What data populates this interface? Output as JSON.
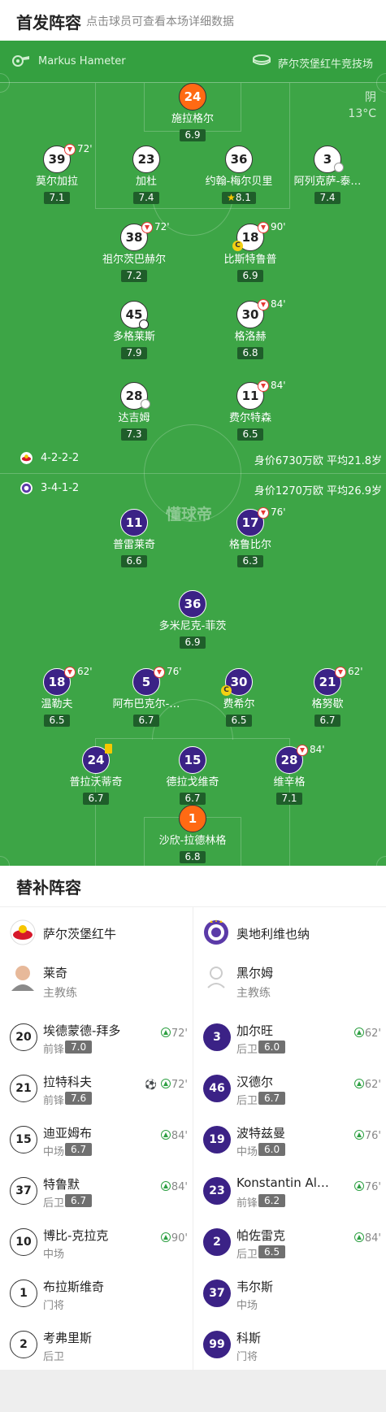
{
  "header": {
    "title": "首发阵容",
    "subtitle": "点击球员可查看本场详细数据"
  },
  "match_info": {
    "referee": "Markus Hameter",
    "venue": "萨尔茨堡红牛竞技场",
    "weather": "阴",
    "temperature": "13°C"
  },
  "home": {
    "formation": "4-2-2-2",
    "value": "身价6730万欧 平均21.8岁",
    "color": "#ffffff"
  },
  "away": {
    "formation": "3-4-1-2",
    "value": "身价1270万欧 平均26.9岁",
    "color": "#3b2286"
  },
  "watermark": "懂球帝",
  "home_players": [
    {
      "num": "24",
      "name": "施拉格尔",
      "rating": "6.9",
      "gk": true
    },
    {
      "num": "39",
      "name": "莫尔加拉",
      "rating": "7.1",
      "sub": "72'"
    },
    {
      "num": "23",
      "name": "加杜",
      "rating": "7.4"
    },
    {
      "num": "36",
      "name": "约翰-梅尔贝里",
      "rating": "8.1",
      "mvp": "★"
    },
    {
      "num": "3",
      "name": "阿列克萨-泰…",
      "rating": "7.4"
    },
    {
      "num": "38",
      "name": "祖尔茨巴赫尔",
      "rating": "7.2",
      "sub": "72'"
    },
    {
      "num": "18",
      "name": "比斯特鲁普",
      "rating": "6.9",
      "sub": "90'",
      "captain": "C"
    },
    {
      "num": "45",
      "name": "多格莱斯",
      "rating": "7.9"
    },
    {
      "num": "30",
      "name": "格洛赫",
      "rating": "6.8",
      "sub": "84'"
    },
    {
      "num": "28",
      "name": "达吉姆",
      "rating": "7.3"
    },
    {
      "num": "11",
      "name": "费尔特森",
      "rating": "6.5",
      "sub": "84'"
    }
  ],
  "away_players": [
    {
      "num": "11",
      "name": "普雷莱奇",
      "rating": "6.6"
    },
    {
      "num": "17",
      "name": "格鲁比尔",
      "rating": "6.3",
      "sub": "76'"
    },
    {
      "num": "36",
      "name": "多米尼克-菲茨",
      "rating": "6.9"
    },
    {
      "num": "18",
      "name": "温勒夫",
      "rating": "6.5",
      "sub": "62'"
    },
    {
      "num": "5",
      "name": "阿布巴克尔-…",
      "rating": "6.7",
      "sub": "76'"
    },
    {
      "num": "30",
      "name": "费希尔",
      "rating": "6.5",
      "captain": "C"
    },
    {
      "num": "21",
      "name": "格努歇",
      "rating": "6.7",
      "sub": "62'"
    },
    {
      "num": "24",
      "name": "普拉沃蒂奇",
      "rating": "6.7"
    },
    {
      "num": "15",
      "name": "德拉戈维奇",
      "rating": "6.7"
    },
    {
      "num": "28",
      "name": "维辛格",
      "rating": "7.1",
      "sub": "84'"
    },
    {
      "num": "1",
      "name": "沙欣-拉德林格",
      "rating": "6.8",
      "gk": true
    }
  ],
  "subs_title": "替补阵容",
  "home_team": "萨尔茨堡红牛",
  "away_team": "奥地利维也纳",
  "home_coach": {
    "name": "莱奇",
    "role": "主教练"
  },
  "away_coach": {
    "name": "黑尔姆",
    "role": "主教练"
  },
  "home_subs": [
    {
      "num": "20",
      "name": "埃德蒙德-拜多",
      "pos": "前锋",
      "rating": "7.0",
      "time": "72'"
    },
    {
      "num": "21",
      "name": "拉特科夫",
      "pos": "前锋",
      "rating": "7.6",
      "time": "72'",
      "goal": "⚽"
    },
    {
      "num": "15",
      "name": "迪亚姆布",
      "pos": "中场",
      "rating": "6.7",
      "time": "84'"
    },
    {
      "num": "37",
      "name": "特鲁默",
      "pos": "后卫",
      "rating": "6.7",
      "time": "84'"
    },
    {
      "num": "10",
      "name": "博比-克拉克",
      "pos": "中场",
      "time": "90'"
    },
    {
      "num": "1",
      "name": "布拉斯维奇",
      "pos": "门将"
    },
    {
      "num": "2",
      "name": "考弗里斯",
      "pos": "后卫"
    }
  ],
  "away_subs": [
    {
      "num": "3",
      "name": "加尔旺",
      "pos": "后卫",
      "rating": "6.0",
      "time": "62'"
    },
    {
      "num": "46",
      "name": "汉德尔",
      "pos": "后卫",
      "rating": "6.7",
      "time": "62'"
    },
    {
      "num": "19",
      "name": "波特兹曼",
      "pos": "中场",
      "rating": "6.0",
      "time": "76'"
    },
    {
      "num": "23",
      "name": "Konstantin Al…",
      "pos": "前锋",
      "rating": "6.2",
      "time": "76'"
    },
    {
      "num": "2",
      "name": "帕佐雷克",
      "pos": "后卫",
      "rating": "6.5",
      "time": "84'"
    },
    {
      "num": "37",
      "name": "韦尔斯",
      "pos": "中场"
    },
    {
      "num": "99",
      "name": "科斯",
      "pos": "门将"
    }
  ]
}
